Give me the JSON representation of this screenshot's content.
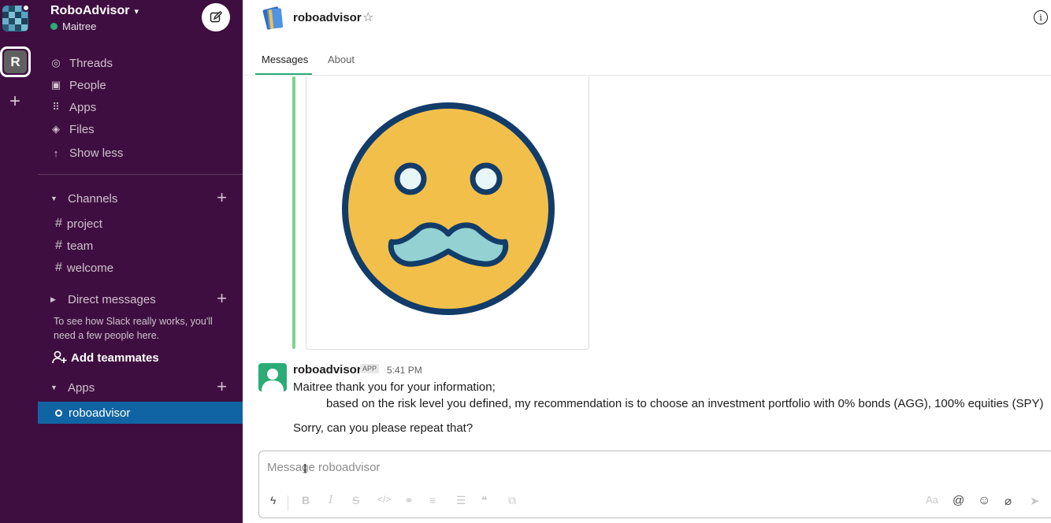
{
  "workspace": {
    "name": "RoboAdvisor",
    "user": "Maitree",
    "initial": "R"
  },
  "sidebar": {
    "nav": [
      {
        "label": "Threads",
        "icon": "threads-icon"
      },
      {
        "label": "People",
        "icon": "people-icon"
      },
      {
        "label": "Apps",
        "icon": "apps-icon"
      },
      {
        "label": "Files",
        "icon": "files-icon"
      },
      {
        "label": "Show less",
        "icon": "arrow-up-icon"
      }
    ],
    "channels_header": "Channels",
    "channels": [
      "project",
      "team",
      "welcome"
    ],
    "dm_header": "Direct messages",
    "dm_hint": "To see how Slack really works, you'll need a few people here.",
    "add_teammates": "Add teammates",
    "apps_header": "Apps",
    "active_app": "roboadvisor"
  },
  "channel": {
    "name": "roboadvisor",
    "tabs": [
      "Messages",
      "About"
    ]
  },
  "message": {
    "sender": "roboadvisor",
    "badge": "APP",
    "time": "5:41 PM",
    "lines": [
      "Maitree thank you for your information;",
      "based on the risk level you defined, my recommendation is to choose an investment portfolio with 0% bonds (AGG), 100% equities (SPY)",
      "Sorry, can you please repeat that?"
    ]
  },
  "composer": {
    "placeholder": "Message roboadvisor",
    "value": ""
  },
  "colors": {
    "sidebar_bg": "#3f0e40",
    "active_item": "#1164a3",
    "presence": "#2bac76",
    "emoji_face": "#f2c04a",
    "emoji_outline": "#123c69",
    "mustache": "#93d1d2"
  }
}
